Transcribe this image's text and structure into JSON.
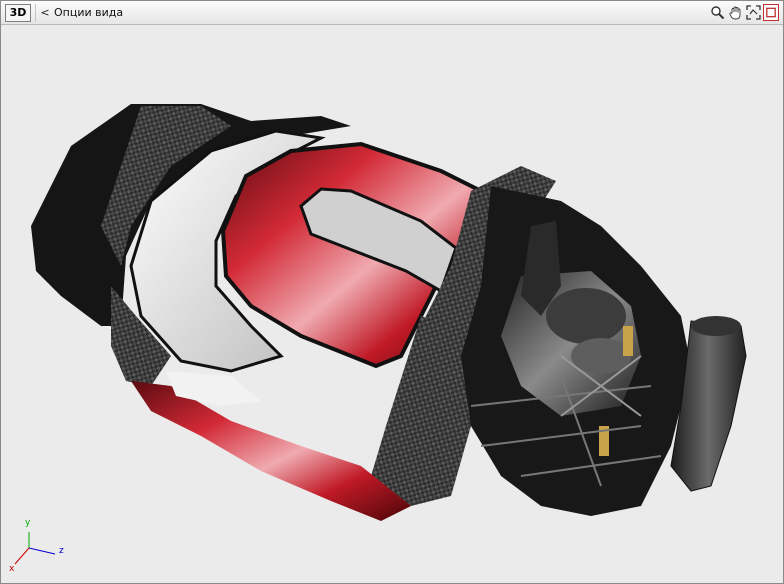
{
  "toolbar": {
    "mode_badge": "3D",
    "back_symbol": "<",
    "view_options_label": "Опции вида"
  },
  "tools": [
    {
      "name": "zoom-icon"
    },
    {
      "name": "pan-icon"
    },
    {
      "name": "fit-view-icon"
    },
    {
      "name": "frame-select-icon"
    }
  ],
  "axes": {
    "y_label": "y",
    "z_label": "z",
    "x_label": "x",
    "colors": {
      "x": "#cc0000",
      "y": "#00aa00",
      "z": "#0000cc"
    }
  },
  "colors": {
    "viewport_bg": "#ebebeb",
    "body_red": "#b0121e",
    "carbon": "#3a3a3a",
    "white_panel": "#d8d8d8"
  }
}
